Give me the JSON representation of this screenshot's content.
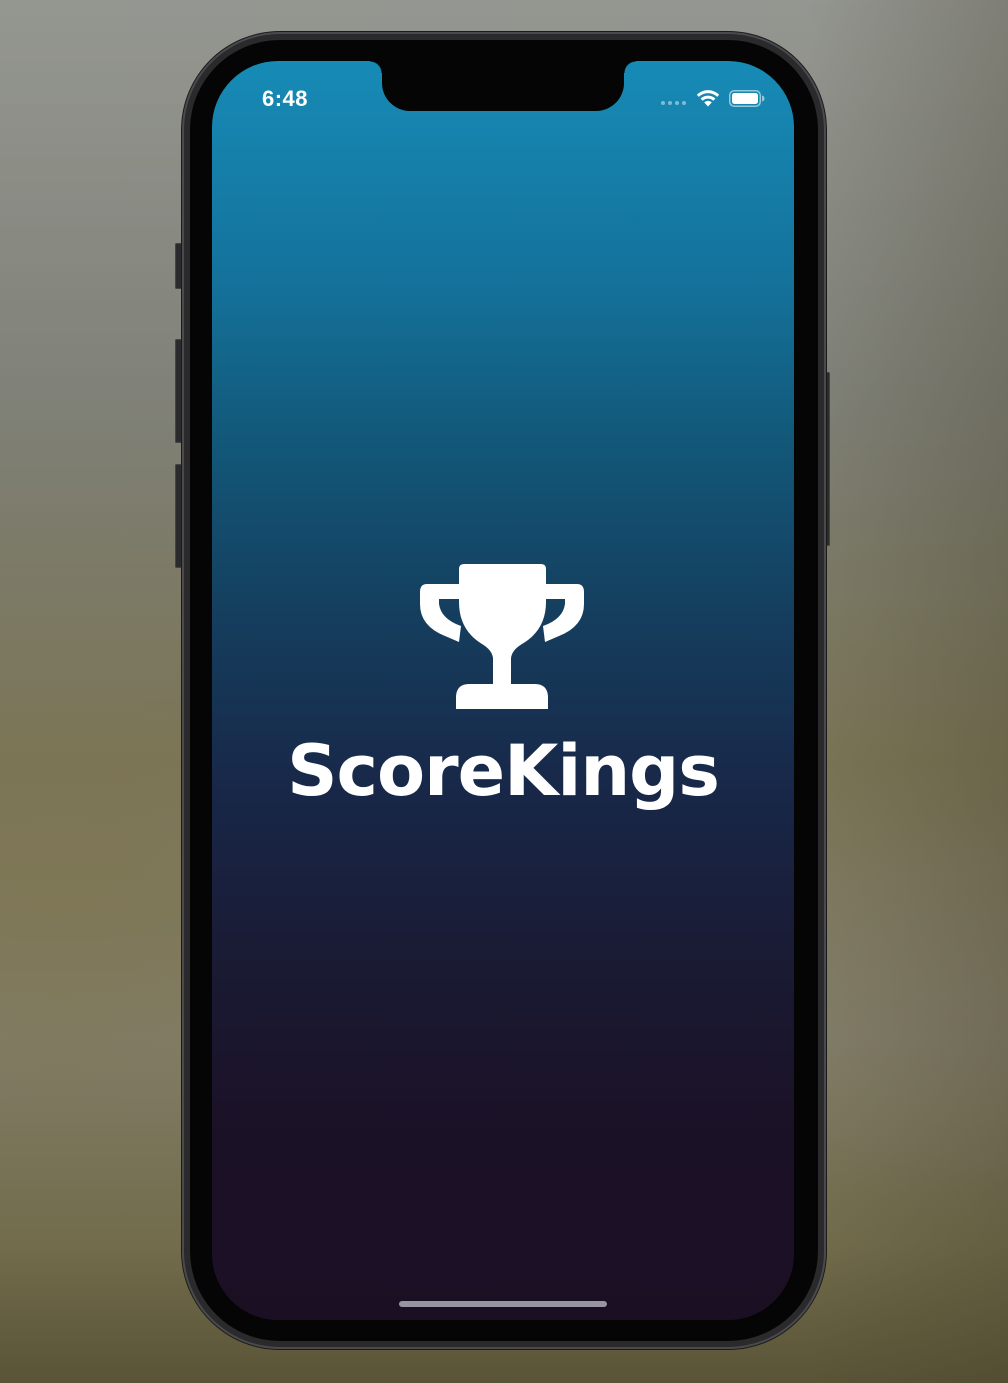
{
  "status_bar": {
    "time": "6:48",
    "wifi_icon": "wifi-icon",
    "battery_icon": "battery-icon",
    "signal_icon": "cellular-signal-dots"
  },
  "splash": {
    "logo_icon": "trophy-icon",
    "app_name": "ScoreKings"
  },
  "colors": {
    "gradient_top": "#168bb6",
    "gradient_bottom": "#1b0f24",
    "text": "#ffffff"
  }
}
